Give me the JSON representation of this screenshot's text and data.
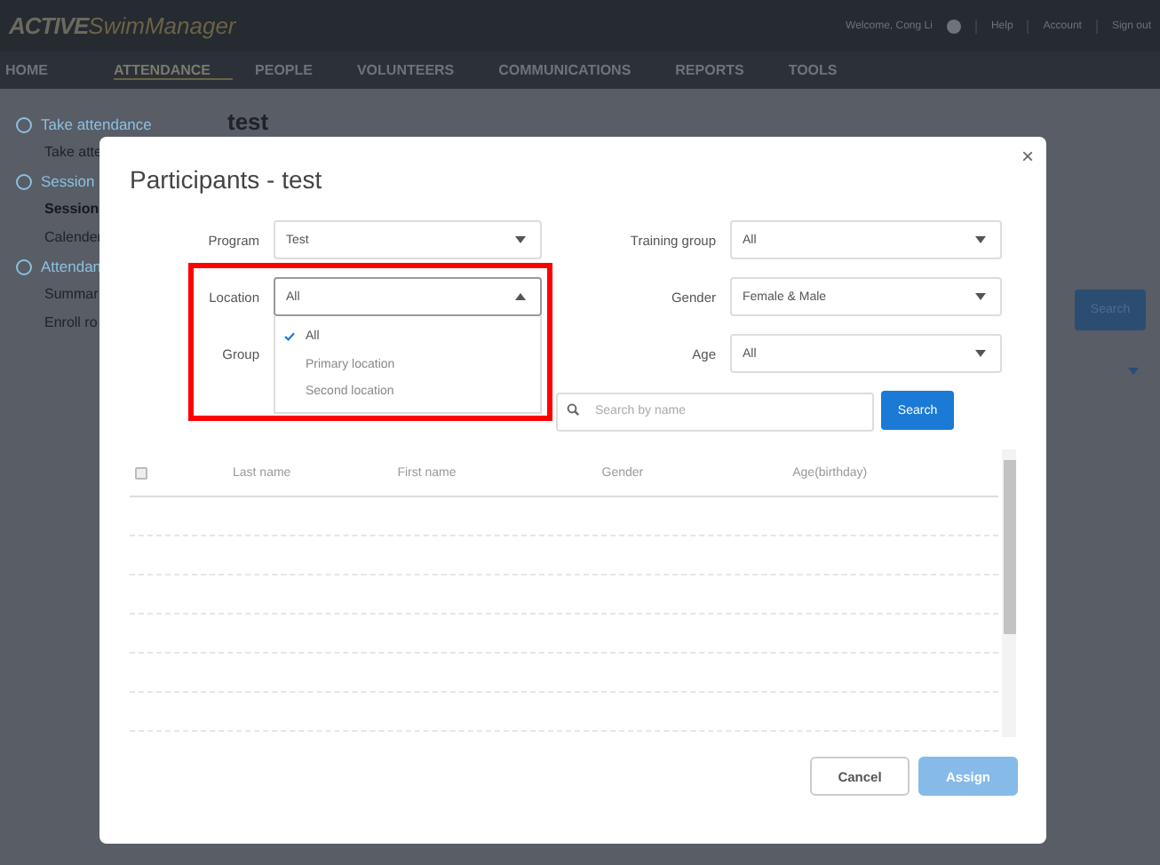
{
  "brand": {
    "main": "ACTIVE",
    "sub": "SwimManager"
  },
  "header_links": {
    "welcome": "Welcome, Cong Li",
    "links": [
      "Help",
      "Account",
      "Sign out"
    ]
  },
  "nav": [
    {
      "label": "HOME",
      "selected": false
    },
    {
      "label": "ATTENDANCE",
      "selected": true
    },
    {
      "label": "PEOPLE",
      "selected": false
    },
    {
      "label": "VOLUNTEERS",
      "selected": false
    },
    {
      "label": "COMMUNICATIONS",
      "selected": false
    },
    {
      "label": "REPORTS",
      "selected": false
    },
    {
      "label": "TOOLS",
      "selected": false
    }
  ],
  "sidebar": [
    {
      "label": "Take attendance",
      "kind": "section",
      "selected": false
    },
    {
      "label": "Take atte",
      "kind": "item",
      "selected": false
    },
    {
      "label": "Session",
      "kind": "section",
      "selected": false
    },
    {
      "label": "Session",
      "kind": "item",
      "selected": true
    },
    {
      "label": "Calender",
      "kind": "item",
      "selected": false
    },
    {
      "label": "Attendan",
      "kind": "section",
      "selected": false
    },
    {
      "label": "Summar",
      "kind": "item",
      "selected": false
    },
    {
      "label": "Enroll ro",
      "kind": "item",
      "selected": false
    }
  ],
  "page": {
    "title": "test",
    "search_button": "Search"
  },
  "dialog": {
    "title": "Participants - test",
    "close": "×",
    "filters_left": [
      {
        "label": "Program",
        "value": "Test",
        "open": false
      },
      {
        "label": "Location",
        "value": "All",
        "open": true
      },
      {
        "label": "Group"
      }
    ],
    "location_options": [
      {
        "label": "All",
        "selected": true
      },
      {
        "label": "Primary location",
        "selected": false
      },
      {
        "label": "Second location",
        "selected": false
      }
    ],
    "filters_right": [
      {
        "label": "Training group",
        "value": "All"
      },
      {
        "label": "Gender",
        "value": "Female & Male"
      },
      {
        "label": "Age",
        "value": "All"
      }
    ],
    "search": {
      "placeholder": "Search by name",
      "button": "Search"
    },
    "table": {
      "select_all_checked": false,
      "columns": [
        "Last name",
        "First name",
        "Gender",
        "Age(birthday)"
      ]
    },
    "buttons": [
      {
        "label": "Cancel",
        "kind": "secondary",
        "disabled": false
      },
      {
        "label": "Assign",
        "kind": "primary",
        "disabled": true
      }
    ]
  },
  "highlight_location": true
}
